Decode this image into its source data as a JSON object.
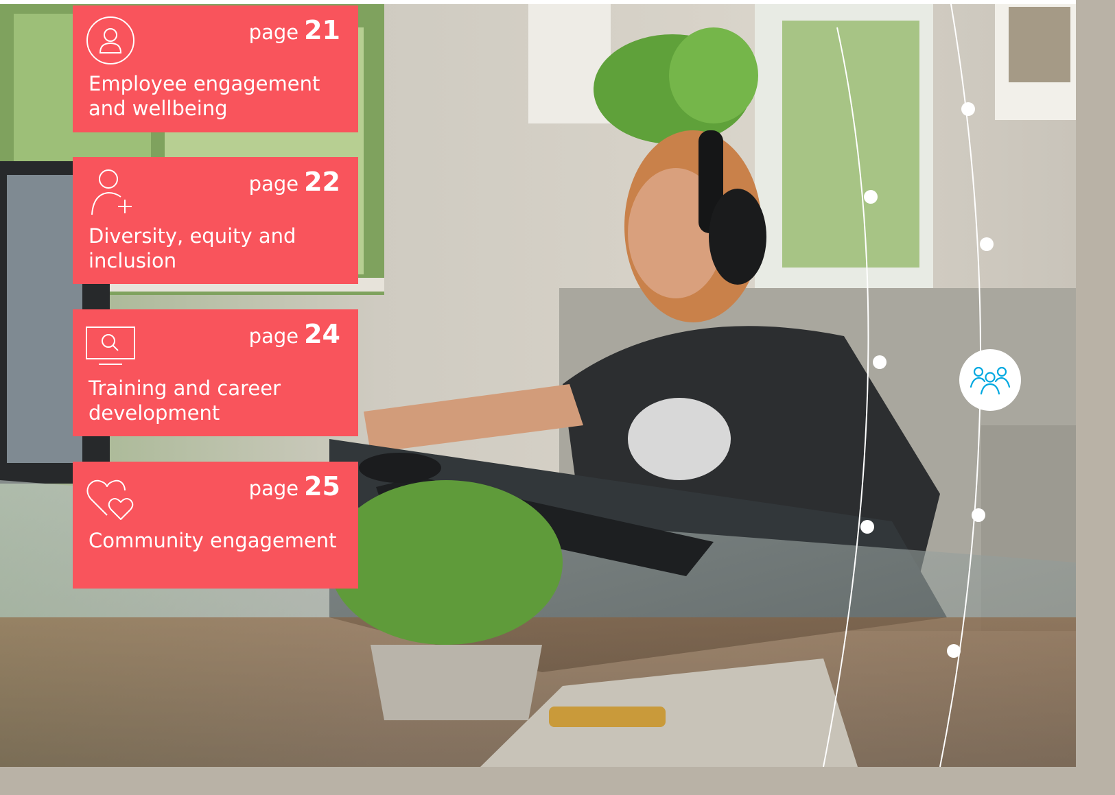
{
  "cards": [
    {
      "page_label": "page",
      "page_number": "21",
      "title": "Employee engagement and wellbeing",
      "icon": "person-icon"
    },
    {
      "page_label": "page",
      "page_number": "22",
      "title": "Diversity, equity and inclusion",
      "icon": "person-add-icon"
    },
    {
      "page_label": "page",
      "page_number": "24",
      "title": "Training and career development",
      "icon": "monitor-search-icon"
    },
    {
      "page_label": "page",
      "page_number": "25",
      "title": "Community engagement",
      "icon": "hearts-icon"
    }
  ],
  "colors": {
    "card_background": "#f9545c",
    "accent_blue": "#00a8e0",
    "white": "#ffffff"
  },
  "badge_icon": "people-group-icon"
}
